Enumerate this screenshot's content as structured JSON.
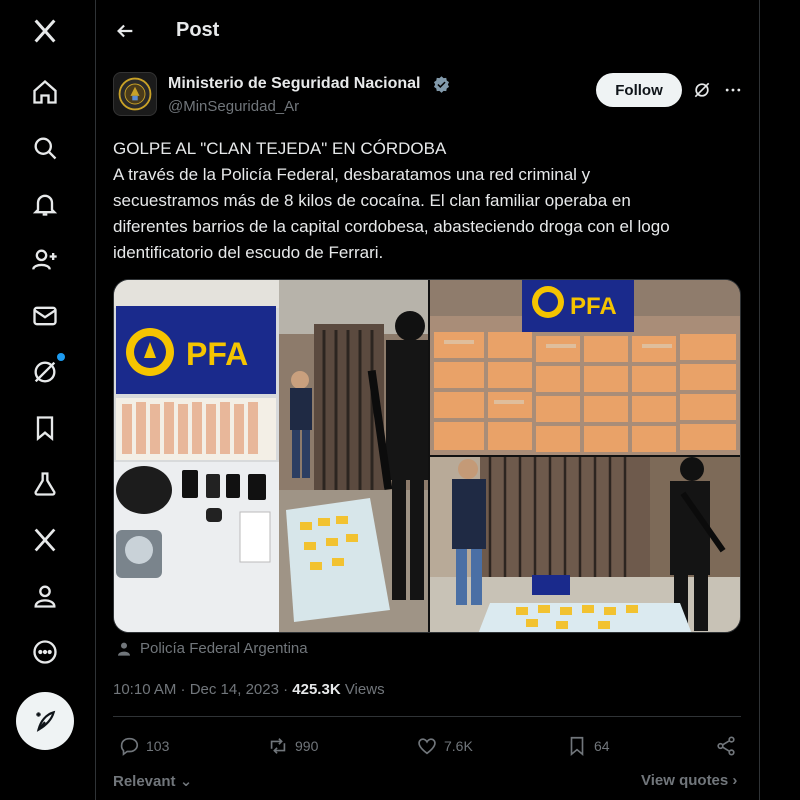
{
  "header": {
    "title": "Post"
  },
  "author": {
    "name": "Ministerio de Seguridad Nacional",
    "handle": "@MinSeguridad_Ar",
    "follow_label": "Follow"
  },
  "tweet": {
    "lines": [
      "GOLPE AL \"CLAN TEJEDA\" EN CÓRDOBA",
      "A través de la Policía Federal, desbaratamos una red criminal y",
      "secuestramos más de 8 kilos de cocaína. El clan familiar operaba en",
      "diferentes barrios de la capital cordobesa, abasteciendo droga con el logo",
      "identificatorio del escudo de Ferrari."
    ]
  },
  "media": {
    "banner_text": "PFA"
  },
  "location": "Policía Federal Argentina",
  "meta": {
    "time": "10:10 AM · Dec 14, 2023 · ",
    "views_count": "425.3K",
    "views_label": " Views"
  },
  "actions": {
    "replies": "103",
    "reposts": "990",
    "likes": "7.6K",
    "bookmarks": "64"
  },
  "footer": {
    "relevant": "Relevant",
    "view_quotes": "View quotes"
  },
  "colors": {
    "accent": "#1d9bf0",
    "background": "#000000",
    "text": "#e7e9ea",
    "muted": "#71767b",
    "pfa_blue": "#1a2a8c",
    "pfa_yellow": "#f5c400"
  },
  "sidebar_icons": [
    "x-logo-icon",
    "home-icon",
    "search-icon",
    "bell-icon",
    "add-user-icon",
    "mail-icon",
    "grok-icon",
    "bookmark-icon",
    "flask-icon",
    "x-premium-icon",
    "profile-icon",
    "more-circle-icon",
    "compose-icon"
  ]
}
